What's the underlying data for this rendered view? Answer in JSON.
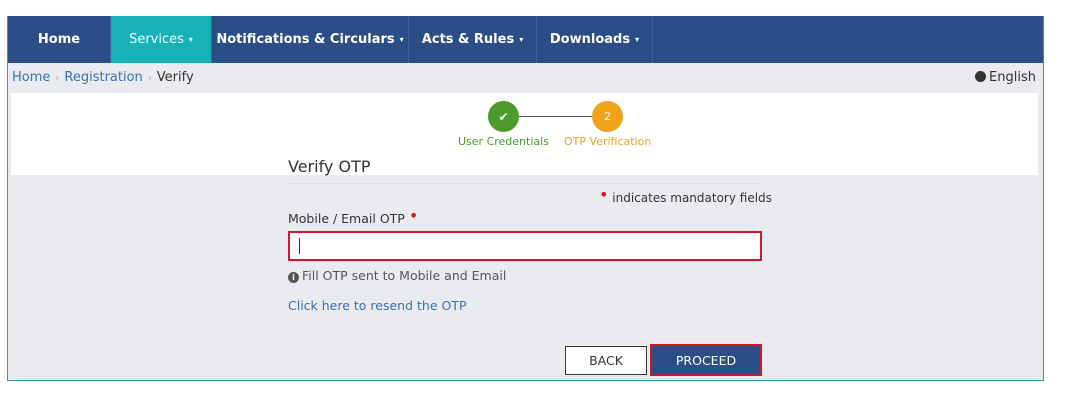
{
  "nav": {
    "items": [
      {
        "label": "Home",
        "dropdown": false
      },
      {
        "label": "Services",
        "dropdown": true,
        "active": true
      },
      {
        "label": "Notifications & Circulars",
        "dropdown": true
      },
      {
        "label": "Acts & Rules",
        "dropdown": true
      },
      {
        "label": "Downloads",
        "dropdown": true
      }
    ],
    "caret": "▾"
  },
  "breadcrumb": {
    "items": [
      "Home",
      "Registration",
      "Verify"
    ],
    "separator": "›"
  },
  "language": {
    "label": "English",
    "icon": "globe-icon"
  },
  "stepper": {
    "steps": [
      {
        "label": "User Credentials",
        "marker": "✔",
        "status": "done"
      },
      {
        "label": "OTP Verification",
        "marker": "2",
        "status": "current"
      }
    ]
  },
  "form": {
    "title": "Verify OTP",
    "mandatory_note": "indicates mandatory fields",
    "otp_label": "Mobile / Email OTP",
    "otp_value": "",
    "hint": "Fill OTP sent to Mobile and Email",
    "resend_link": "Click here to resend the OTP",
    "back_label": "BACK",
    "proceed_label": "PROCEED"
  },
  "colors": {
    "nav_bg": "#2c4e86",
    "nav_active": "#17b2b8",
    "step_done": "#4b9b2a",
    "step_current": "#f0a21b",
    "highlight_border": "#d0192c",
    "link": "#3772b2",
    "required_dot": "#e0131a"
  }
}
